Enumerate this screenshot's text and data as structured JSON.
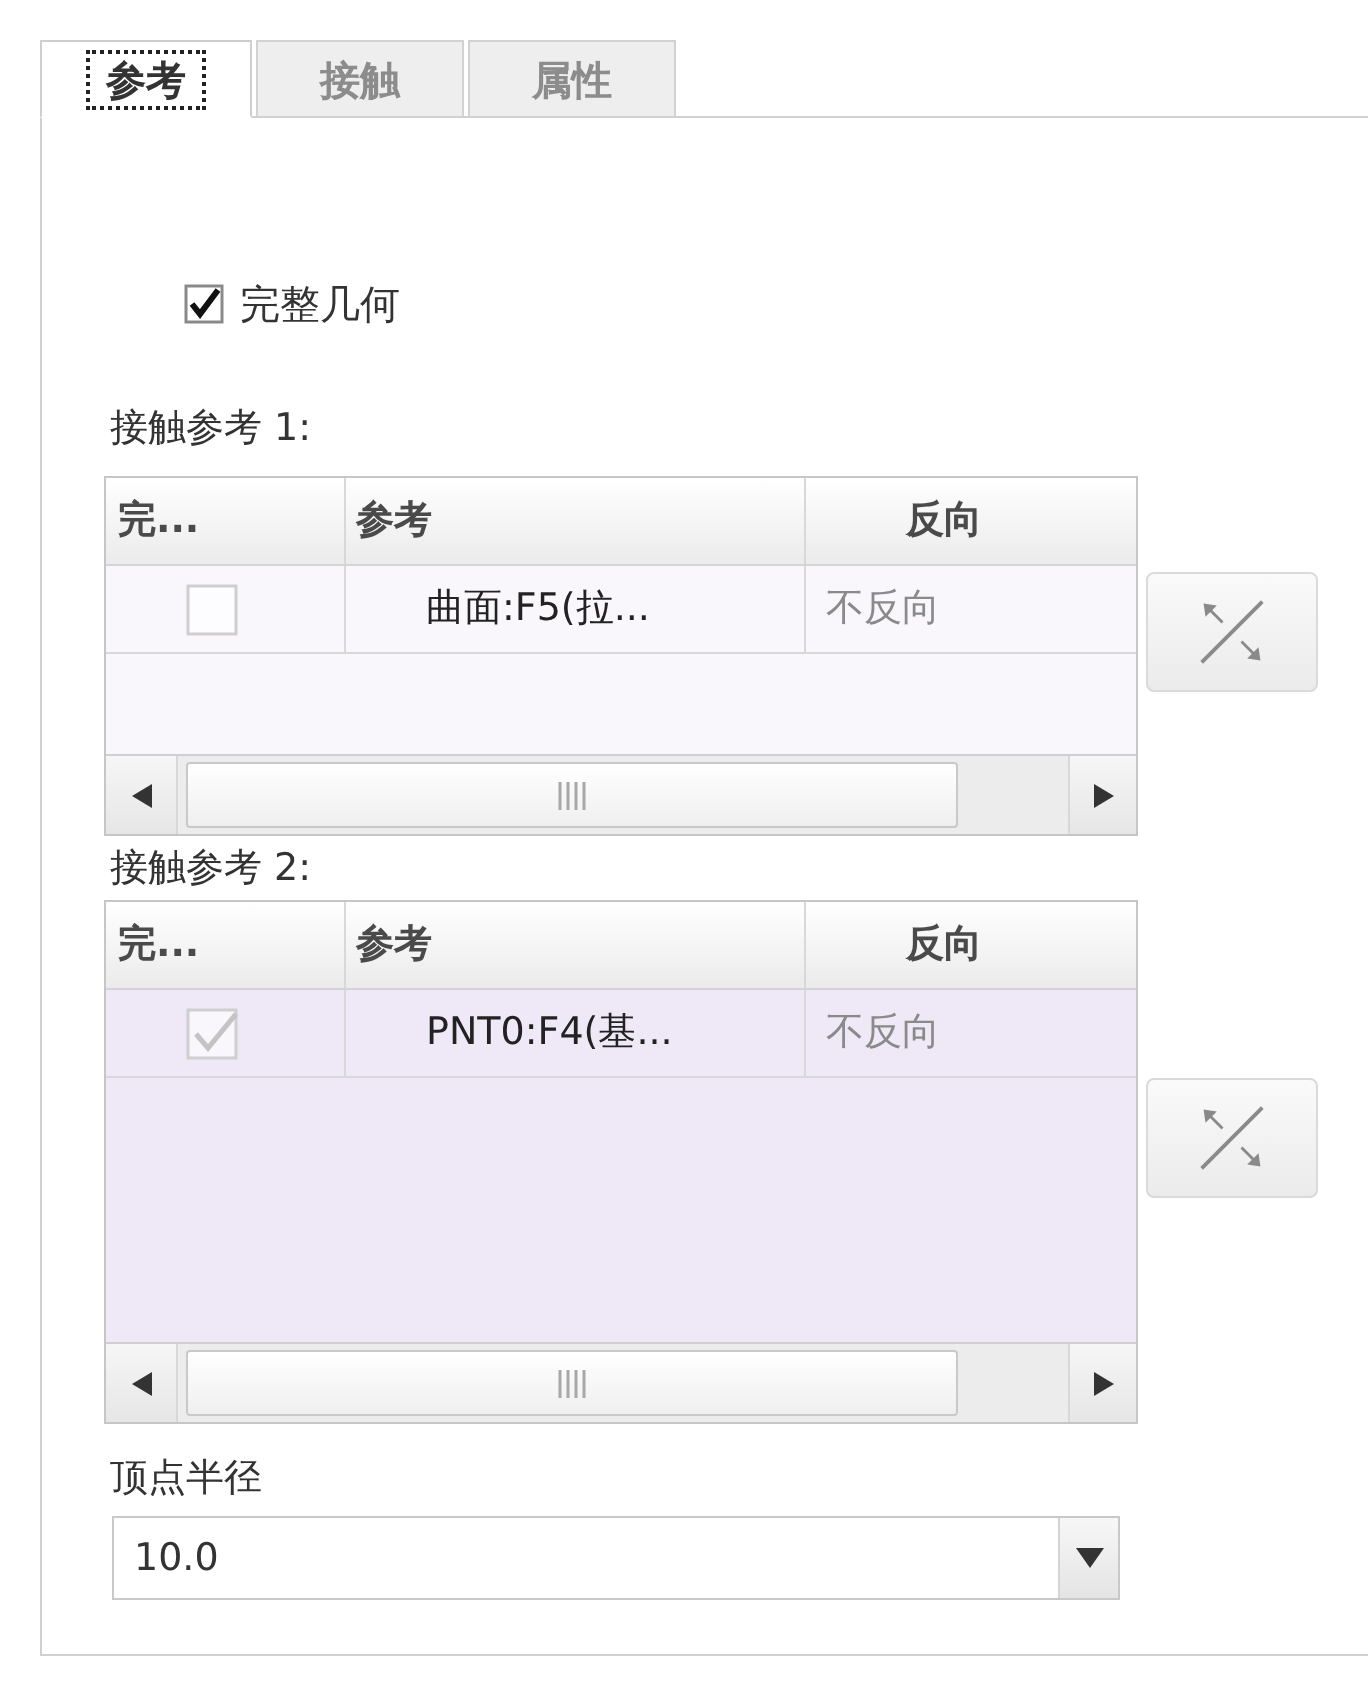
{
  "tabs": [
    {
      "label": "参考",
      "selected": true
    },
    {
      "label": "接触",
      "selected": false
    },
    {
      "label": "属性",
      "selected": false
    }
  ],
  "full_geometry": {
    "label": "完整几何",
    "checked": true
  },
  "contact_references": [
    {
      "label": "接触参考 1:",
      "active": false,
      "columns": [
        "完...",
        "参考",
        "反向"
      ],
      "rows": [
        {
          "checked": false,
          "reference": "曲面:F5(拉...",
          "direction": "不反向"
        }
      ]
    },
    {
      "label": "接触参考 2:",
      "active": true,
      "columns": [
        "完...",
        "参考",
        "反向"
      ],
      "rows": [
        {
          "checked": true,
          "reference": "PNT0:F4(基...",
          "direction": "不反向"
        }
      ]
    }
  ],
  "vertex_radius": {
    "label": "顶点半径",
    "value": "10.0"
  }
}
